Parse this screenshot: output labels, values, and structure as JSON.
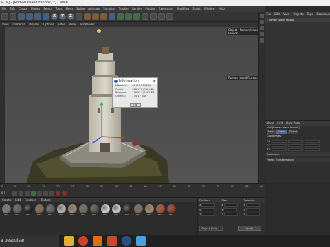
{
  "window": {
    "title": "R19] - [Roman Island Fanook] *] - Main"
  },
  "main_menu": [
    "File",
    "Edit",
    "Create",
    "Modes",
    "Select",
    "Tools",
    "Mesh",
    "Spline",
    "Animate",
    "Simulate",
    "Tracker",
    "Render",
    "Plugins",
    "Extensions",
    "RealFlow",
    "Script",
    "Window",
    "Help"
  ],
  "viewport_menu": [
    "View",
    "Cameras",
    "Display",
    "Options",
    "Filter",
    "Panel",
    "ProRender"
  ],
  "axis_buttons": [
    "X",
    "Y",
    "Z"
  ],
  "viewport": {
    "camera_label": "Object - Roman Island Fanook",
    "info_label": "Roman Island Fanook"
  },
  "dialog": {
    "title": "Information",
    "rows": [
      {
        "key": "Materials:",
        "value": "44 (17,879/KB)"
      },
      {
        "key": "Points:",
        "value": "106,970 (968,KB)"
      },
      {
        "key": "Polygons:",
        "value": "119,537 (1697 KB)"
      },
      {
        "key": "Objects:",
        "value": "1 (4,17 KB)"
      }
    ],
    "ok_label": "OK"
  },
  "object_manager": {
    "menu": [
      "File",
      "Edit",
      "View",
      "Objects",
      "Tags",
      "Bookmarks"
    ],
    "item": "Roman Island Fanook"
  },
  "attribute_manager": {
    "menu": [
      "Mode",
      "Edit",
      "User Data"
    ],
    "object_line": "Null [Roman Island Fanook]",
    "tabs": [
      {
        "label": "Basic",
        "selected": false
      },
      {
        "label": "Coord.",
        "selected": true
      },
      {
        "label": "Object",
        "selected": false
      }
    ],
    "coord_title": "Coordinates",
    "coord_rows": [
      "P.X",
      "P.Y",
      "P.Z"
    ],
    "sections": [
      "Quaternion",
      "Freeze Transformation"
    ]
  },
  "timeline": {
    "ticks": [
      "0",
      "5",
      "10",
      "15",
      "20",
      "25",
      "30",
      "35",
      "40",
      "45",
      "50",
      "55",
      "60",
      "65",
      "70",
      "75",
      "80",
      "85",
      "90"
    ],
    "frame": "0 F"
  },
  "material_manager": {
    "menu": [
      "Create",
      "Edit",
      "Function",
      "Texture"
    ],
    "materials": [
      {
        "label": "Mat",
        "color": "#7a7a7a"
      },
      {
        "label": "Mat",
        "color": "#5e5e5e"
      },
      {
        "label": "Mat",
        "color": "#222222"
      },
      {
        "label": "Mat",
        "color": "#8b6a4a"
      },
      {
        "label": "Mat",
        "color": "#5a5a5a"
      },
      {
        "label": "Mat",
        "color": "#bdb6a8"
      },
      {
        "label": "Mat",
        "color": "#9d8a6f"
      },
      {
        "label": "Mat",
        "color": "#696f5c"
      },
      {
        "label": "Mat",
        "color": "#4b5842"
      },
      {
        "label": "Mat",
        "color": "#d5d5d5"
      },
      {
        "label": "Mat",
        "color": "#cccccc"
      },
      {
        "label": "Mat",
        "color": "#2a2a2a"
      },
      {
        "label": "Mat",
        "color": "#7b6b5b"
      },
      {
        "label": "Mat",
        "color": "#a8886b"
      },
      {
        "label": "Mat",
        "color": "#b34a2b"
      },
      {
        "label": "Mat",
        "color": "#8a3a1e"
      }
    ]
  },
  "coordinate_manager": {
    "headers": [
      "Position",
      "Size",
      "Rotation"
    ],
    "rows": [
      {
        "pos": "X",
        "size": "X",
        "rot": "H"
      },
      {
        "pos": "Y",
        "size": "Y",
        "rot": "P"
      },
      {
        "pos": "Z",
        "size": "Z",
        "rot": "B"
      }
    ],
    "mode": "Object (Rel)",
    "apply_label": "Apply"
  },
  "taskbar": {
    "search_text": "a pesquisar"
  }
}
